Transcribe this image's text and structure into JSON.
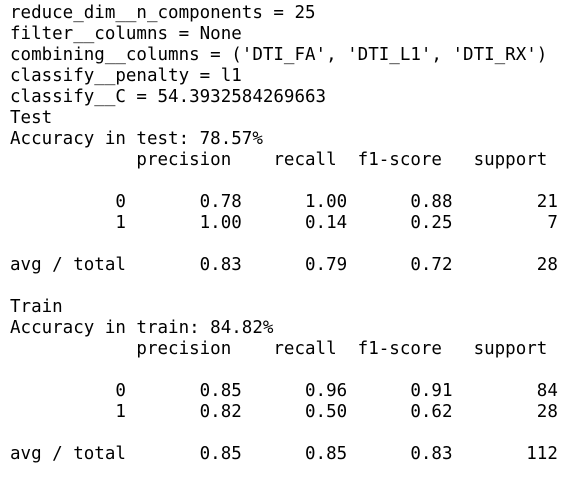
{
  "params": [
    "reduce_dim__n_components = 25",
    "filter__columns = None",
    "combining__columns = ('DTI_FA', 'DTI_L1', 'DTI_RX')",
    "classify__penalty = l1",
    "classify__C = 54.3932584269663"
  ],
  "test": {
    "heading": "Test",
    "accuracy": "Accuracy in test: 78.57%",
    "header_row": "            precision    recall  f1-score   support",
    "rows": [
      "          0       0.78      1.00      0.88        21",
      "          1       1.00      0.14      0.25         7"
    ],
    "avg_row": "avg / total       0.83      0.79      0.72        28"
  },
  "train": {
    "heading": "Train",
    "accuracy": "Accuracy in train: 84.82%",
    "header_row": "            precision    recall  f1-score   support",
    "rows": [
      "          0       0.85      0.96      0.91        84",
      "          1       0.82      0.50      0.62        28"
    ],
    "avg_row": "avg / total       0.85      0.85      0.83       112"
  }
}
